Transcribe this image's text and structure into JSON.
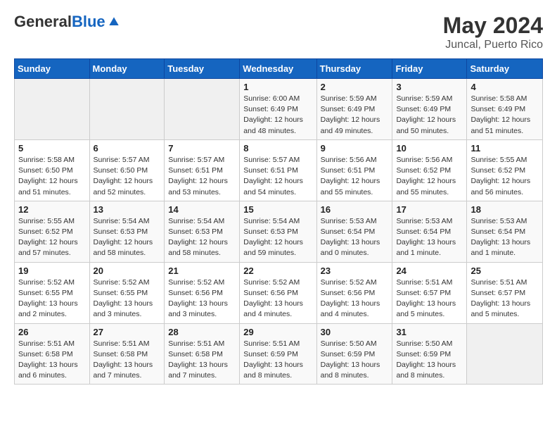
{
  "header": {
    "logo_general": "General",
    "logo_blue": "Blue",
    "month_title": "May 2024",
    "location": "Juncal, Puerto Rico"
  },
  "days_of_week": [
    "Sunday",
    "Monday",
    "Tuesday",
    "Wednesday",
    "Thursday",
    "Friday",
    "Saturday"
  ],
  "weeks": [
    [
      {
        "day": "",
        "info": ""
      },
      {
        "day": "",
        "info": ""
      },
      {
        "day": "",
        "info": ""
      },
      {
        "day": "1",
        "info": "Sunrise: 6:00 AM\nSunset: 6:49 PM\nDaylight: 12 hours\nand 48 minutes."
      },
      {
        "day": "2",
        "info": "Sunrise: 5:59 AM\nSunset: 6:49 PM\nDaylight: 12 hours\nand 49 minutes."
      },
      {
        "day": "3",
        "info": "Sunrise: 5:59 AM\nSunset: 6:49 PM\nDaylight: 12 hours\nand 50 minutes."
      },
      {
        "day": "4",
        "info": "Sunrise: 5:58 AM\nSunset: 6:49 PM\nDaylight: 12 hours\nand 51 minutes."
      }
    ],
    [
      {
        "day": "5",
        "info": "Sunrise: 5:58 AM\nSunset: 6:50 PM\nDaylight: 12 hours\nand 51 minutes."
      },
      {
        "day": "6",
        "info": "Sunrise: 5:57 AM\nSunset: 6:50 PM\nDaylight: 12 hours\nand 52 minutes."
      },
      {
        "day": "7",
        "info": "Sunrise: 5:57 AM\nSunset: 6:51 PM\nDaylight: 12 hours\nand 53 minutes."
      },
      {
        "day": "8",
        "info": "Sunrise: 5:57 AM\nSunset: 6:51 PM\nDaylight: 12 hours\nand 54 minutes."
      },
      {
        "day": "9",
        "info": "Sunrise: 5:56 AM\nSunset: 6:51 PM\nDaylight: 12 hours\nand 55 minutes."
      },
      {
        "day": "10",
        "info": "Sunrise: 5:56 AM\nSunset: 6:52 PM\nDaylight: 12 hours\nand 55 minutes."
      },
      {
        "day": "11",
        "info": "Sunrise: 5:55 AM\nSunset: 6:52 PM\nDaylight: 12 hours\nand 56 minutes."
      }
    ],
    [
      {
        "day": "12",
        "info": "Sunrise: 5:55 AM\nSunset: 6:52 PM\nDaylight: 12 hours\nand 57 minutes."
      },
      {
        "day": "13",
        "info": "Sunrise: 5:54 AM\nSunset: 6:53 PM\nDaylight: 12 hours\nand 58 minutes."
      },
      {
        "day": "14",
        "info": "Sunrise: 5:54 AM\nSunset: 6:53 PM\nDaylight: 12 hours\nand 58 minutes."
      },
      {
        "day": "15",
        "info": "Sunrise: 5:54 AM\nSunset: 6:53 PM\nDaylight: 12 hours\nand 59 minutes."
      },
      {
        "day": "16",
        "info": "Sunrise: 5:53 AM\nSunset: 6:54 PM\nDaylight: 13 hours\nand 0 minutes."
      },
      {
        "day": "17",
        "info": "Sunrise: 5:53 AM\nSunset: 6:54 PM\nDaylight: 13 hours\nand 1 minute."
      },
      {
        "day": "18",
        "info": "Sunrise: 5:53 AM\nSunset: 6:54 PM\nDaylight: 13 hours\nand 1 minute."
      }
    ],
    [
      {
        "day": "19",
        "info": "Sunrise: 5:52 AM\nSunset: 6:55 PM\nDaylight: 13 hours\nand 2 minutes."
      },
      {
        "day": "20",
        "info": "Sunrise: 5:52 AM\nSunset: 6:55 PM\nDaylight: 13 hours\nand 3 minutes."
      },
      {
        "day": "21",
        "info": "Sunrise: 5:52 AM\nSunset: 6:56 PM\nDaylight: 13 hours\nand 3 minutes."
      },
      {
        "day": "22",
        "info": "Sunrise: 5:52 AM\nSunset: 6:56 PM\nDaylight: 13 hours\nand 4 minutes."
      },
      {
        "day": "23",
        "info": "Sunrise: 5:52 AM\nSunset: 6:56 PM\nDaylight: 13 hours\nand 4 minutes."
      },
      {
        "day": "24",
        "info": "Sunrise: 5:51 AM\nSunset: 6:57 PM\nDaylight: 13 hours\nand 5 minutes."
      },
      {
        "day": "25",
        "info": "Sunrise: 5:51 AM\nSunset: 6:57 PM\nDaylight: 13 hours\nand 5 minutes."
      }
    ],
    [
      {
        "day": "26",
        "info": "Sunrise: 5:51 AM\nSunset: 6:58 PM\nDaylight: 13 hours\nand 6 minutes."
      },
      {
        "day": "27",
        "info": "Sunrise: 5:51 AM\nSunset: 6:58 PM\nDaylight: 13 hours\nand 7 minutes."
      },
      {
        "day": "28",
        "info": "Sunrise: 5:51 AM\nSunset: 6:58 PM\nDaylight: 13 hours\nand 7 minutes."
      },
      {
        "day": "29",
        "info": "Sunrise: 5:51 AM\nSunset: 6:59 PM\nDaylight: 13 hours\nand 8 minutes."
      },
      {
        "day": "30",
        "info": "Sunrise: 5:50 AM\nSunset: 6:59 PM\nDaylight: 13 hours\nand 8 minutes."
      },
      {
        "day": "31",
        "info": "Sunrise: 5:50 AM\nSunset: 6:59 PM\nDaylight: 13 hours\nand 8 minutes."
      },
      {
        "day": "",
        "info": ""
      }
    ]
  ]
}
